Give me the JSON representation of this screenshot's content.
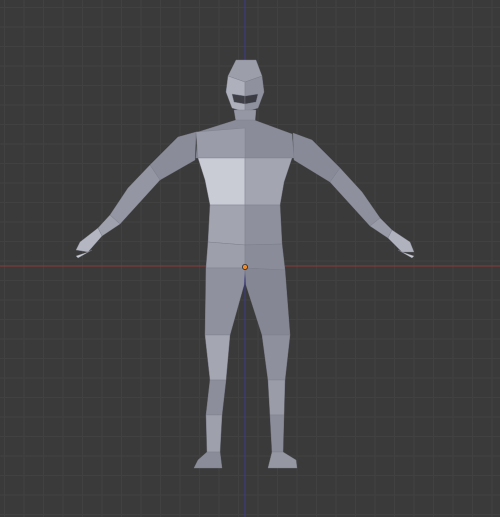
{
  "viewport": {
    "editor": "3d-viewport",
    "view": "front-orthographic",
    "background_color": "#3a3a3a",
    "grid_color": "#414141",
    "x_axis_color": "#8a3a3a",
    "z_axis_color": "#3a3a8a",
    "object": {
      "name": "",
      "type": "low-poly-human-mesh",
      "pose": "a-pose",
      "base_color": "#8d8f9c",
      "origin_marker_color": "#f08a2a",
      "selected": false
    }
  }
}
